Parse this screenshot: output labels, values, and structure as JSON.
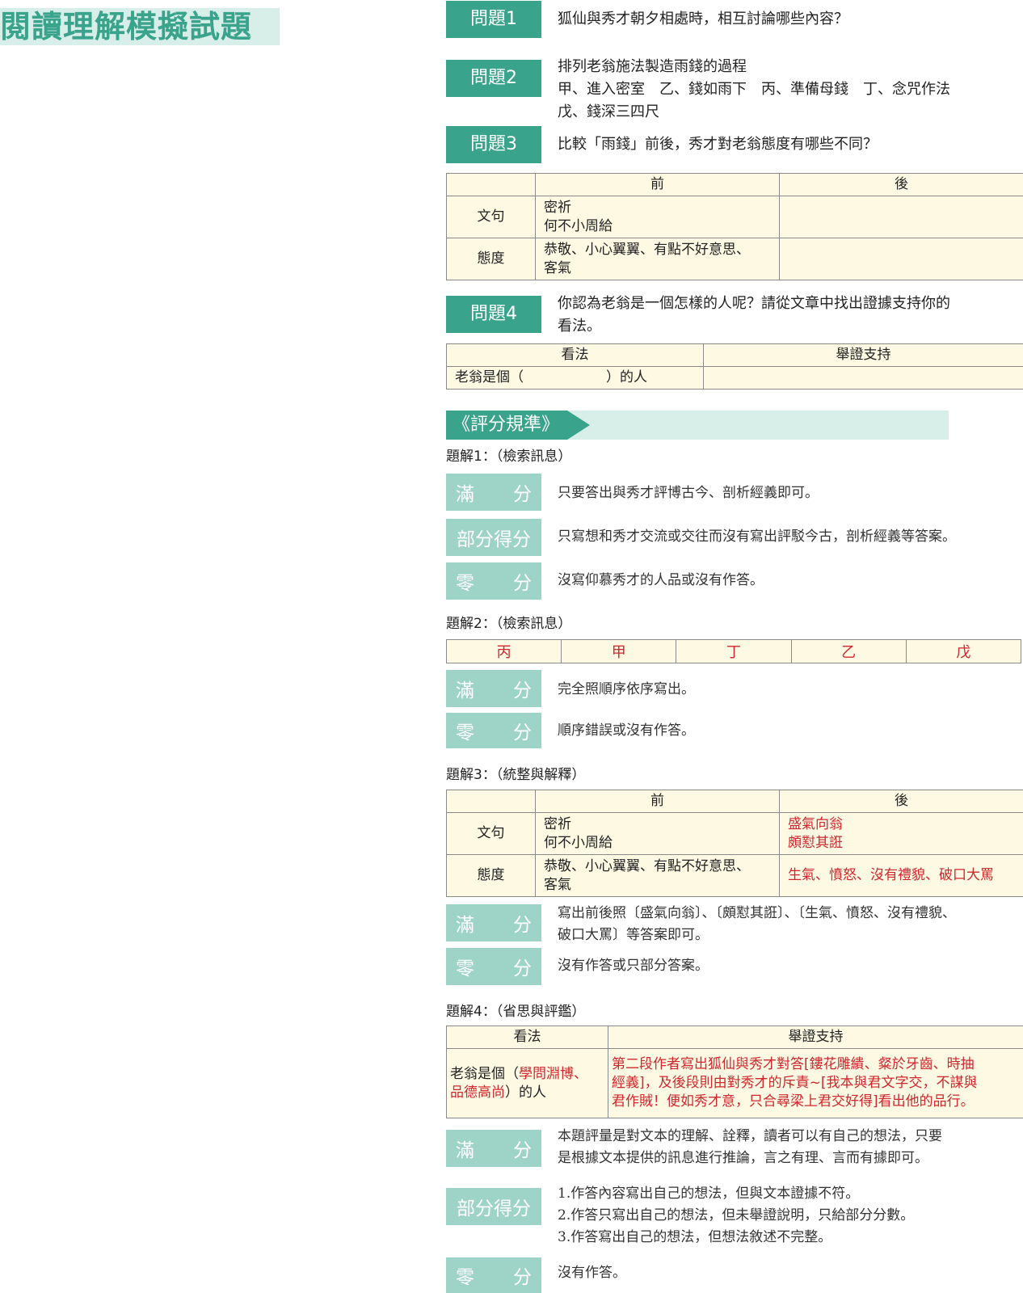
{
  "page_title": "閱讀理解模擬試題",
  "questions": [
    {
      "tag": "問題1",
      "lines": [
        "狐仙與秀才朝夕相處時，相互討論哪些內容？"
      ]
    },
    {
      "tag": "問題2",
      "lines": [
        "排列老翁施法製造雨錢的過程",
        "甲、進入密室　乙、錢如雨下　丙、準備母錢　丁、念咒作法",
        "戊、錢深三四尺"
      ]
    },
    {
      "tag": "問題3",
      "lines": [
        "比較「雨錢」前後，秀才對老翁態度有哪些不同？"
      ]
    },
    {
      "tag": "問題4",
      "lines": [
        "你認為老翁是一個怎樣的人呢？請從文章中找出證據支持你的",
        "看法。"
      ]
    }
  ],
  "q3_table": {
    "head_before": "前",
    "head_after": "後",
    "row1_label": "文句",
    "row1_before": [
      "密祈",
      "何不小周給"
    ],
    "row1_after": [
      "",
      ""
    ],
    "row2_label": "態度",
    "row2_before": [
      "恭敬、小心翼翼、有點不好意思、",
      "客氣"
    ],
    "row2_after": ""
  },
  "q4_table": {
    "head_view": "看法",
    "head_support": "舉證支持",
    "view": "老翁是個（　　　　　　）的人",
    "support": ""
  },
  "rubric_title": "《評分規準》",
  "answer1": {
    "title": "題解1：（檢索訊息）",
    "full_label_a": "滿",
    "full_label_b": "分",
    "full_text": "只要答出與秀才評博古今、剖析經義即可。",
    "partial_label": "部分得分",
    "partial_text": "只寫想和秀才交流或交往而沒有寫出評駁今古，剖析經義等答案。",
    "zero_label_a": "零",
    "zero_label_b": "分",
    "zero_text": "沒寫仰慕秀才的人品或沒有作答。"
  },
  "answer2": {
    "title": "題解2：（檢索訊息）",
    "order": [
      "丙",
      "甲",
      "丁",
      "乙",
      "戊"
    ],
    "full_label_a": "滿",
    "full_label_b": "分",
    "full_text": "完全照順序依序寫出。",
    "zero_label_a": "零",
    "zero_label_b": "分",
    "zero_text": "順序錯誤或沒有作答。"
  },
  "answer3": {
    "title": "題解3：（統整與解釋）",
    "head_before": "前",
    "head_after": "後",
    "row1_label": "文句",
    "row1_before": [
      "密祈",
      "何不小周給"
    ],
    "row1_after": [
      "盛氣向翁",
      "頗懟其誑"
    ],
    "row2_label": "態度",
    "row2_before": [
      "恭敬、小心翼翼、有點不好意思、",
      "客氣"
    ],
    "row2_after": "生氣、憤怒、沒有禮貌、破口大罵",
    "full_label_a": "滿",
    "full_label_b": "分",
    "full_text": [
      "寫出前後照〔盛氣向翁〕、〔頗懟其誑〕、〔生氣、憤怒、沒有禮貌、",
      "破口大罵〕等答案即可。"
    ],
    "zero_label_a": "零",
    "zero_label_b": "分",
    "zero_text": "沒有作答或只部分答案。"
  },
  "answer4": {
    "title": "題解4：（省思與評鑑）",
    "head_view": "看法",
    "head_support": "舉證支持",
    "view_prefix": "老翁是個（",
    "view_answer_1": "學問淵博、",
    "view_answer_2": "品德高尚",
    "view_suffix": "）的人",
    "support": [
      "第二段作者寫出狐仙與秀才對答[鏤花雕繢、粲於牙齒、時抽",
      "經義]，及後段則由對秀才的斥責~[我本與君文字交，不謀與",
      "君作賊！便如秀才意，只合尋梁上君交好得]看出他的品行。"
    ],
    "full_label_a": "滿",
    "full_label_b": "分",
    "full_text": [
      "本題評量是對文本的理解、詮釋，讀者可以有自己的想法，只要",
      "是根據文本提供的訊息進行推論，言之有理、言而有據即可。"
    ],
    "partial_label": "部分得分",
    "partial_text": [
      "1.作答內容寫出自己的想法，但與文本證據不符。",
      "2.作答只寫出自己的想法，但未舉證說明，只給部分分數。",
      "3.作答寫出自己的想法，但想法敘述不完整。"
    ],
    "zero_label_a": "零",
    "zero_label_b": "分",
    "zero_text": "沒有作答。"
  }
}
